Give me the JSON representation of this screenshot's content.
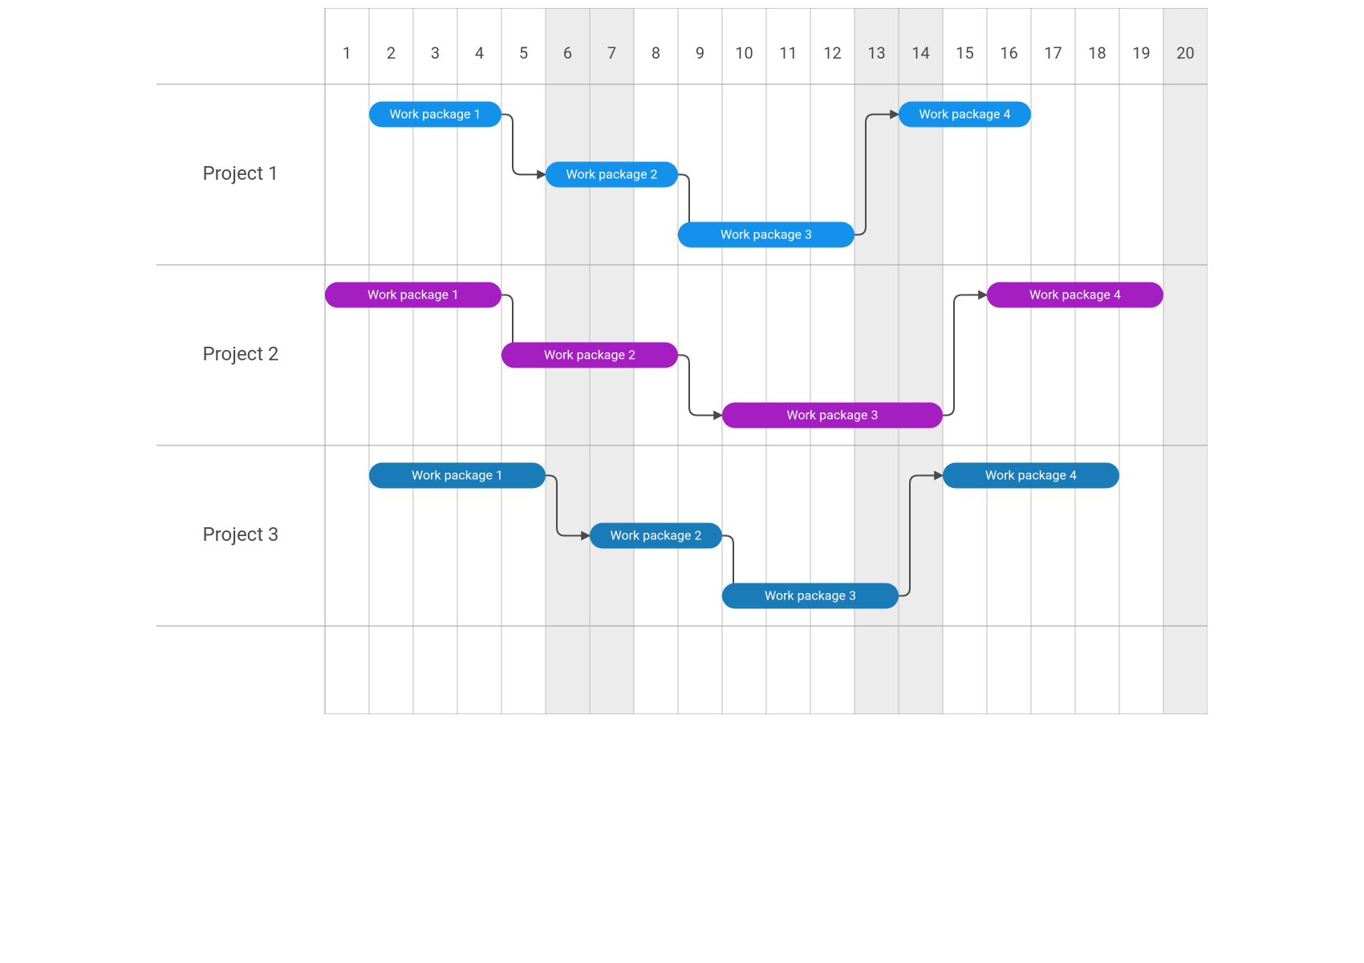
{
  "chart_data": {
    "type": "gantt",
    "columns": 20,
    "shaded_columns": [
      6,
      7,
      13,
      14,
      20
    ],
    "row_labels": [
      "Project 1",
      "Project 2",
      "Project 3"
    ],
    "projects": [
      {
        "name": "Project 1",
        "color": "#1391eb",
        "tasks": [
          {
            "label": "Work package 1",
            "start": 2,
            "end": 4
          },
          {
            "label": "Work package 2",
            "start": 6,
            "end": 8
          },
          {
            "label": "Work package 3",
            "start": 9,
            "end": 12
          },
          {
            "label": "Work package 4",
            "start": 14,
            "end": 16
          }
        ],
        "dependencies": [
          {
            "from": 0,
            "to": 1,
            "dir": "down"
          },
          {
            "from": 1,
            "to": 2,
            "dir": "down"
          },
          {
            "from": 2,
            "to": 3,
            "dir": "up"
          }
        ]
      },
      {
        "name": "Project 2",
        "color": "#a51ec2",
        "tasks": [
          {
            "label": "Work package 1",
            "start": 1,
            "end": 4
          },
          {
            "label": "Work package 2",
            "start": 5,
            "end": 8
          },
          {
            "label": "Work package 3",
            "start": 10,
            "end": 14
          },
          {
            "label": "Work package 4",
            "start": 16,
            "end": 19
          }
        ],
        "dependencies": [
          {
            "from": 0,
            "to": 1,
            "dir": "down"
          },
          {
            "from": 1,
            "to": 2,
            "dir": "down"
          },
          {
            "from": 2,
            "to": 3,
            "dir": "up"
          }
        ]
      },
      {
        "name": "Project 3",
        "color": "#1a7bb9",
        "tasks": [
          {
            "label": "Work package 1",
            "start": 2,
            "end": 5
          },
          {
            "label": "Work package 2",
            "start": 7,
            "end": 9
          },
          {
            "label": "Work package 3",
            "start": 10,
            "end": 13
          },
          {
            "label": "Work package 4",
            "start": 15,
            "end": 18
          }
        ],
        "dependencies": [
          {
            "from": 0,
            "to": 1,
            "dir": "down"
          },
          {
            "from": 1,
            "to": 2,
            "dir": "down"
          },
          {
            "from": 2,
            "to": 3,
            "dir": "up"
          }
        ]
      }
    ]
  }
}
